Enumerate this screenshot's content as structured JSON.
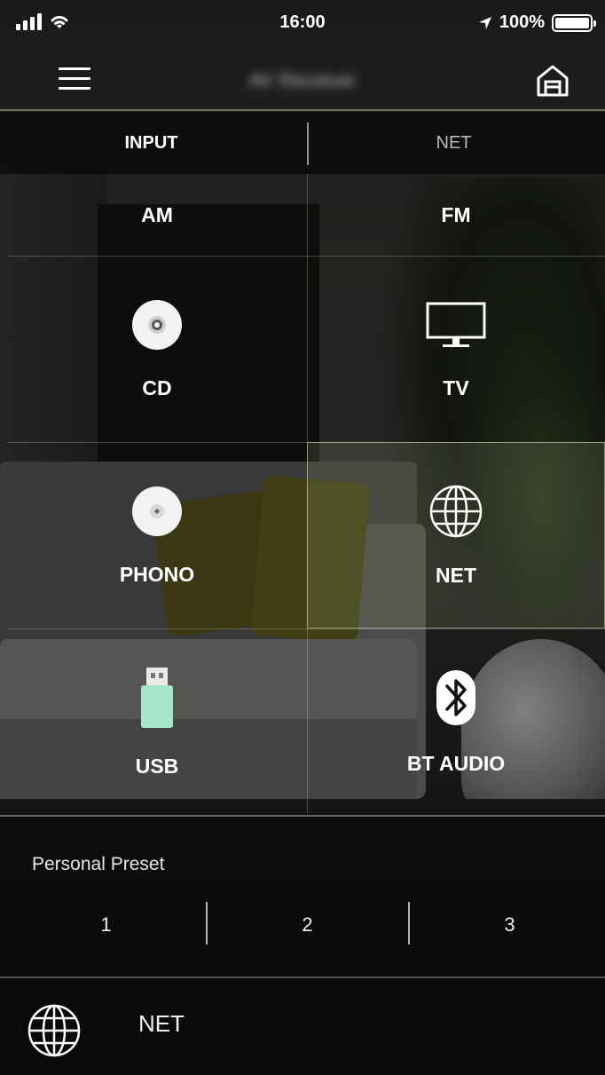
{
  "status_bar": {
    "time": "16:00",
    "battery": "100%"
  },
  "header": {
    "title": "AV Receiver",
    "menu_icon": "hamburger-menu-icon",
    "home_icon": "home-icon"
  },
  "tabs": [
    {
      "label": "INPUT",
      "active": true
    },
    {
      "label": "NET",
      "active": false
    }
  ],
  "sources": [
    {
      "label": "AM",
      "icon": null,
      "selected": false
    },
    {
      "label": "FM",
      "icon": null,
      "selected": false
    },
    {
      "label": "CD",
      "icon": "disc-icon",
      "selected": false
    },
    {
      "label": "TV",
      "icon": "tv-icon",
      "selected": false
    },
    {
      "label": "PHONO",
      "icon": "record-icon",
      "selected": false
    },
    {
      "label": "NET",
      "icon": "globe-icon",
      "selected": true
    },
    {
      "label": "USB",
      "icon": "usb-drive-icon",
      "selected": false
    },
    {
      "label": "BT AUDIO",
      "icon": "bluetooth-icon",
      "selected": false
    }
  ],
  "personal_preset": {
    "title": "Personal Preset",
    "items": [
      "1",
      "2",
      "3"
    ]
  },
  "now_playing": {
    "icon": "globe-icon",
    "label": "NET"
  },
  "colors": {
    "usb_accent": "#a8e6cc",
    "selected_border": "#d2d7b4"
  }
}
